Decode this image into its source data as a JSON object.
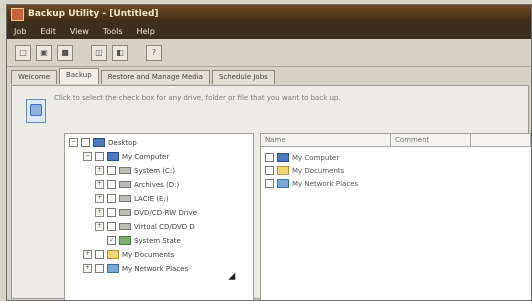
{
  "window": {
    "title": "Backup Utility - [Untitled]"
  },
  "menu": [
    "Job",
    "Edit",
    "View",
    "Tools",
    "Help"
  ],
  "toolbar": {
    "icons": [
      "new-icon",
      "open-icon",
      "save-icon",
      "backup-icon",
      "restore-icon",
      "help-icon"
    ]
  },
  "tabs": [
    "Welcome",
    "Backup",
    "Restore and Manage Media",
    "Schedule Jobs"
  ],
  "instruction": "Click to select the check box for any drive, folder or file that you want to back up.",
  "tree": {
    "items": [
      {
        "label": "Desktop",
        "expander": "−",
        "checked": "",
        "icon": "desktop-icon"
      },
      {
        "label": "My Computer",
        "expander": "−",
        "checked": "",
        "icon": "computer-icon"
      },
      {
        "label": "System (C:)",
        "expander": "+",
        "checked": "",
        "icon": "drive-icon"
      },
      {
        "label": "Archives (D:)",
        "expander": "+",
        "checked": "",
        "icon": "drive-icon"
      },
      {
        "label": "LACIE (E:)",
        "expander": "+",
        "checked": "",
        "icon": "drive-icon"
      },
      {
        "label": "DVD/CD-RW Drive",
        "expander": "+",
        "checked": "",
        "icon": "drive-icon"
      },
      {
        "label": "Virtual CD/DVD D",
        "expander": "+",
        "checked": "",
        "icon": "drive-icon"
      },
      {
        "label": "System State",
        "expander": "",
        "checked": "✓",
        "icon": "system-state-icon"
      },
      {
        "label": "My Documents",
        "expander": "+",
        "checked": "",
        "icon": "folder-icon"
      },
      {
        "label": "My Network Places",
        "expander": "+",
        "checked": "",
        "icon": "network-icon"
      }
    ]
  },
  "details": {
    "columns": [
      "Name",
      "Comment"
    ],
    "rows": [
      {
        "label": "My Computer",
        "icon": "computer-icon"
      },
      {
        "label": "My Documents",
        "icon": "folder-icon"
      },
      {
        "label": "My Network Places",
        "icon": "network-icon"
      }
    ]
  }
}
